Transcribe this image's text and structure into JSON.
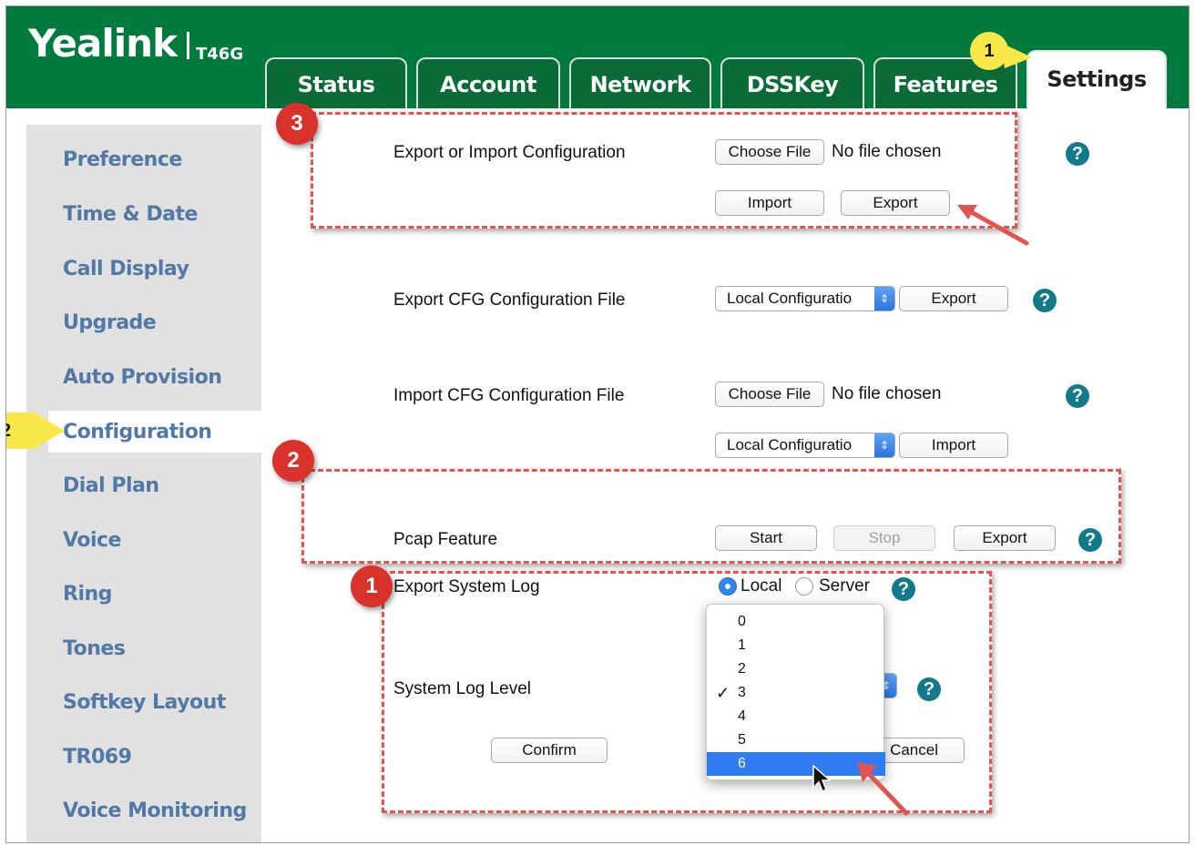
{
  "brand": {
    "logo": "Yealink",
    "model": "T46G"
  },
  "tabs": [
    {
      "label": "Status"
    },
    {
      "label": "Account"
    },
    {
      "label": "Network"
    },
    {
      "label": "DSSKey"
    },
    {
      "label": "Features"
    },
    {
      "label": "Settings",
      "active": true
    }
  ],
  "sidebar": {
    "items": [
      {
        "label": "Preference"
      },
      {
        "label": "Time & Date"
      },
      {
        "label": "Call Display"
      },
      {
        "label": "Upgrade"
      },
      {
        "label": "Auto Provision"
      },
      {
        "label": "Configuration",
        "active": true
      },
      {
        "label": "Dial Plan"
      },
      {
        "label": "Voice"
      },
      {
        "label": "Ring"
      },
      {
        "label": "Tones"
      },
      {
        "label": "Softkey Layout"
      },
      {
        "label": "TR069"
      },
      {
        "label": "Voice Monitoring"
      }
    ]
  },
  "config_section": {
    "label": "Export or Import Configuration",
    "choose_file": "Choose File",
    "no_file": "No file chosen",
    "import": "Import",
    "export": "Export"
  },
  "export_cfg": {
    "label": "Export CFG Configuration File",
    "select_value": "Local Configuratio",
    "export": "Export"
  },
  "import_cfg": {
    "label": "Import CFG Configuration File",
    "choose_file": "Choose File",
    "no_file": "No file chosen",
    "select_value": "Local Configuratio",
    "import": "Import"
  },
  "pcap": {
    "label": "Pcap Feature",
    "start": "Start",
    "stop": "Stop",
    "export": "Export"
  },
  "syslog": {
    "export_label": "Export System Log",
    "local": "Local",
    "server": "Server",
    "local_selected": true,
    "level_label": "System Log Level",
    "confirm": "Confirm",
    "cancel": "Cancel"
  },
  "log_level_menu": {
    "options": [
      "0",
      "1",
      "2",
      "3",
      "4",
      "5",
      "6"
    ],
    "checked": "3",
    "highlighted": "6"
  },
  "help_icon": "?",
  "annotations": {
    "tab_pointer": "1",
    "sidebar_pointer": "2",
    "callout_config": "3",
    "callout_pcap": "2",
    "callout_syslog": "1"
  },
  "colors": {
    "header_green": "#007a3d",
    "sidebar_link": "#5279a6",
    "callout_red": "#d9322b",
    "pointer_yellow": "#f9e84a",
    "help_teal": "#127a8a",
    "select_blue": "#2e7cf0"
  }
}
